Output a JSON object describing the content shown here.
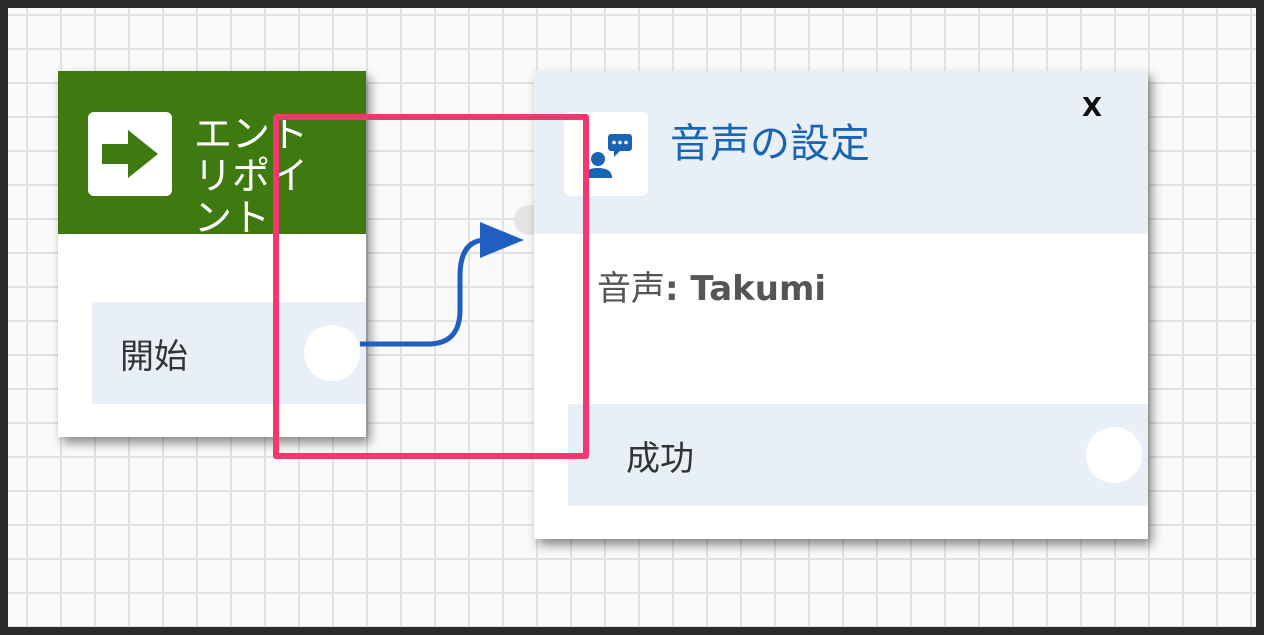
{
  "entry_block": {
    "title": "エントリポイント",
    "icon": "arrow-right-icon",
    "start_label": "開始",
    "header_color": "#3f7a10"
  },
  "voice_block": {
    "title": "音声の設定",
    "icon": "speaking-person-icon",
    "close_label": "X",
    "voice_key": "音声",
    "voice_value": ": Takumi",
    "success_label": "成功",
    "title_color": "#1a64b4"
  },
  "connector": {
    "color": "#1f5fc1"
  },
  "highlight": {
    "color": "#f4376e"
  }
}
